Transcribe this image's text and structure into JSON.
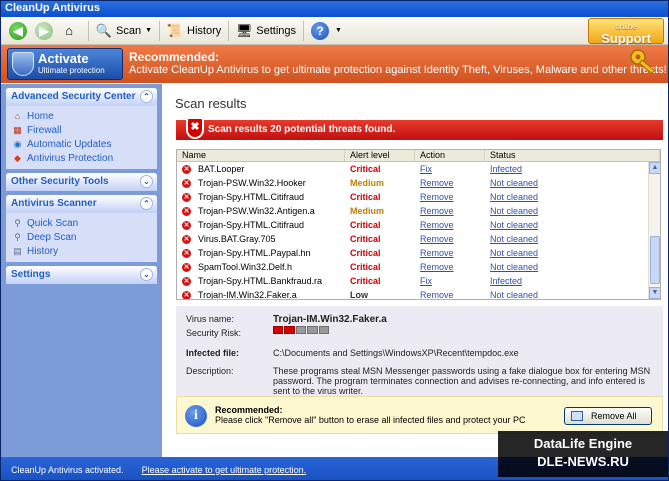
{
  "window": {
    "title": "CleanUp Antivirus"
  },
  "toolbar": {
    "scan_label": "Scan",
    "history_label": "History",
    "settings_label": "Settings",
    "support_small": "online",
    "support_label": "Support"
  },
  "banner": {
    "activate_title": "Activate",
    "activate_subtitle": "Ultimate protection",
    "rec_title": "Recommended:",
    "rec_text": "Activate CleanUp Antivirus to get ultimate protection against Identity Theft, Viruses, Malware and other threats!"
  },
  "sidebar": {
    "security_center": {
      "title": "Advanced Security Center",
      "items": [
        "Home",
        "Firewall",
        "Automatic Updates",
        "Antivirus Protection"
      ]
    },
    "other_tools": {
      "title": "Other Security Tools"
    },
    "scanner": {
      "title": "Antivirus Scanner",
      "items": [
        "Quick Scan",
        "Deep Scan",
        "History"
      ]
    },
    "settings": {
      "title": "Settings"
    }
  },
  "main": {
    "title": "Scan results",
    "alert": "Scan results 20 potential threats found.",
    "columns": [
      "Name",
      "Alert level",
      "Action",
      "Status"
    ],
    "rows": [
      {
        "name": "BAT.Looper",
        "level": "Critical",
        "action": "Fix",
        "status": "Infected"
      },
      {
        "name": "Trojan-PSW.Win32.Hooker",
        "level": "Medium",
        "action": "Remove",
        "status": "Not cleaned"
      },
      {
        "name": "Trojan-Spy.HTML.Citifraud",
        "level": "Critical",
        "action": "Remove",
        "status": "Not cleaned"
      },
      {
        "name": "Trojan-PSW.Win32.Antigen.a",
        "level": "Medium",
        "action": "Remove",
        "status": "Not cleaned"
      },
      {
        "name": "Trojan-Spy.HTML.Citifraud",
        "level": "Critical",
        "action": "Remove",
        "status": "Not cleaned"
      },
      {
        "name": "Virus.BAT.Gray.705",
        "level": "Critical",
        "action": "Remove",
        "status": "Not cleaned"
      },
      {
        "name": "Trojan-Spy.HTML.Paypal.hn",
        "level": "Critical",
        "action": "Remove",
        "status": "Not cleaned"
      },
      {
        "name": "SpamTool.Win32.Delf.h",
        "level": "Critical",
        "action": "Remove",
        "status": "Not cleaned"
      },
      {
        "name": "Trojan-Spy.HTML.Bankfraud.ra",
        "level": "Critical",
        "action": "Fix",
        "status": "Infected"
      },
      {
        "name": "Trojan-IM.Win32.Faker.a",
        "level": "Low",
        "action": "Remove",
        "status": "Not cleaned"
      }
    ],
    "details": {
      "virus_label": "Virus name:",
      "virus_value": "Trojan-IM.Win32.Faker.a",
      "risk_label": "Security Risk:",
      "risk_level": 2,
      "risk_max": 5,
      "file_label": "Infected file:",
      "file_value": "C:\\Documents and Settings\\WindowsXP\\Recent\\tempdoc.exe",
      "desc_label": "Description:",
      "desc_value": "These programs steal MSN Messenger passwords using a fake dialogue box for entering MSN password. The program terminates connection and advises re-connecting, and info entered is sent to the virus writer."
    },
    "recommend": {
      "title": "Recommended:",
      "text": "Please click \"Remove all\" button to erase all infected files and protect your PC",
      "button": "Remove All"
    }
  },
  "status": {
    "text": "CleanUp Antivirus activated.",
    "link": "Please activate to get ultimate protection."
  },
  "watermark": {
    "line1": "DataLife Engine",
    "line2": "DLE-NEWS.RU"
  }
}
